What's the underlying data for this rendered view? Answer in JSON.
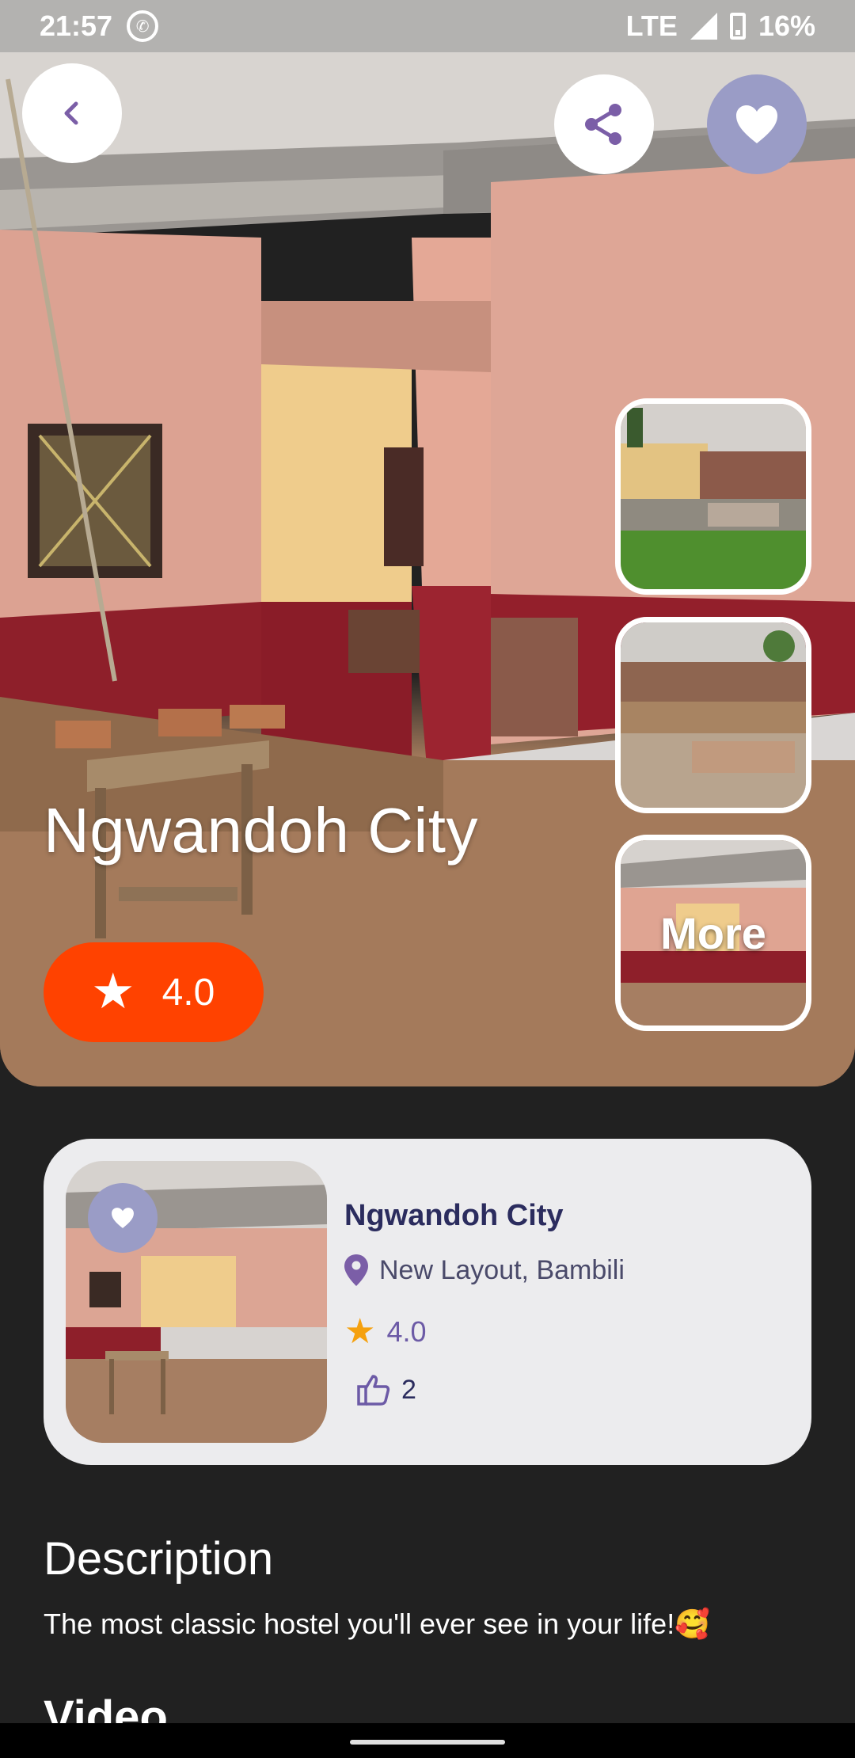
{
  "status_bar": {
    "time": "21:57",
    "network": "LTE",
    "battery": "16%"
  },
  "hero": {
    "title": "Ngwandoh City",
    "rating": "4.0",
    "more_label": "More"
  },
  "card": {
    "title": "Ngwandoh City",
    "location": "New Layout, Bambili",
    "rating": "4.0",
    "likes": "2"
  },
  "description": {
    "heading": "Description",
    "text": "The most classic hostel you'll ever see in your life!🥰"
  },
  "video": {
    "heading": "Video"
  },
  "colors": {
    "accent_purple": "#7b5ea7",
    "favorite_bg": "#9a9cc6",
    "rating_badge": "#ff4200",
    "star": "#f5a10f",
    "background": "#212121",
    "card_bg": "#ececee"
  }
}
